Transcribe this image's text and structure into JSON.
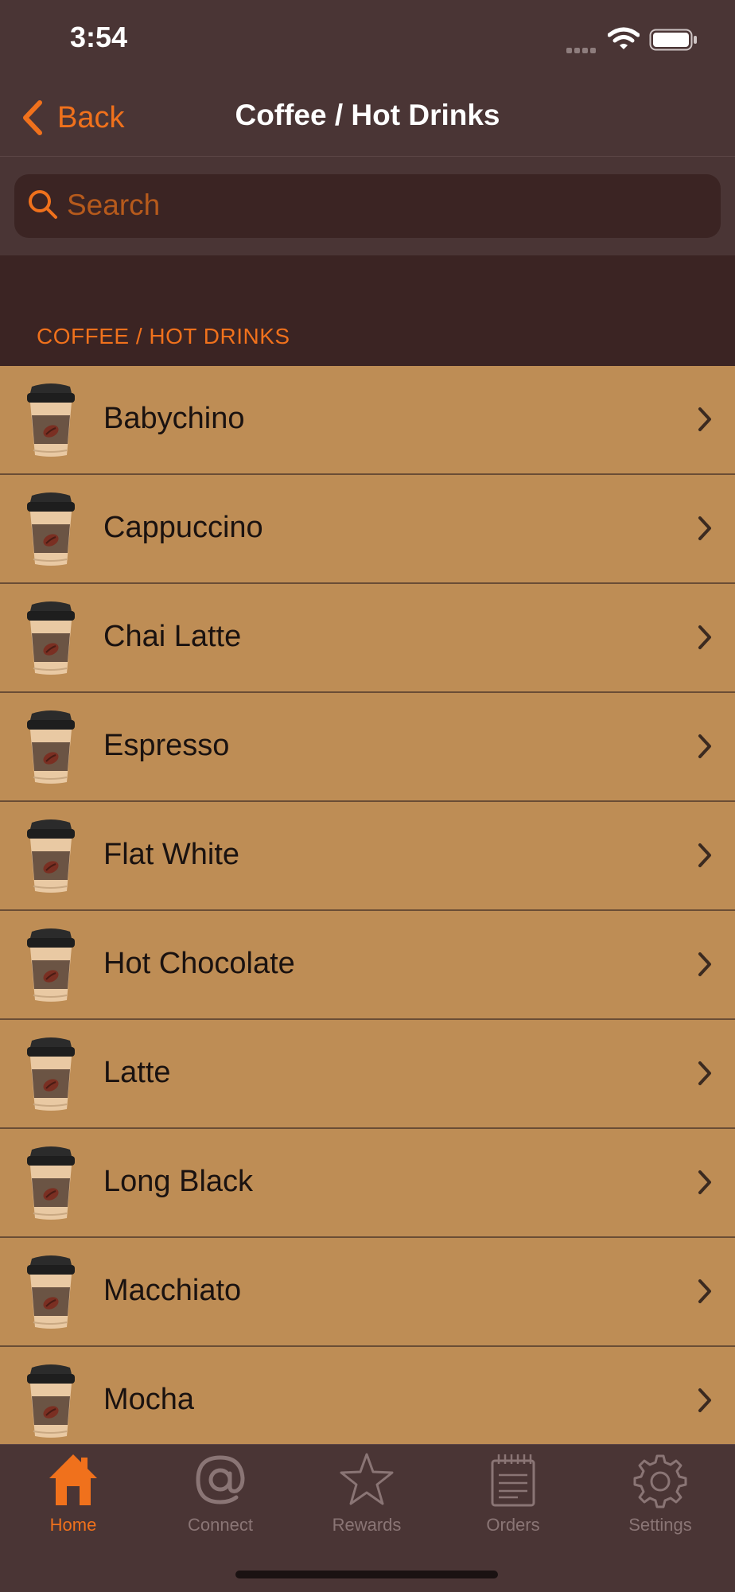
{
  "status_bar": {
    "time": "3:54"
  },
  "nav": {
    "back_label": "Back",
    "title": "Coffee / Hot Drinks"
  },
  "search": {
    "placeholder": "Search"
  },
  "section": {
    "title": "COFFEE / HOT DRINKS"
  },
  "items": [
    {
      "label": "Babychino"
    },
    {
      "label": "Cappuccino"
    },
    {
      "label": "Chai Latte"
    },
    {
      "label": "Espresso"
    },
    {
      "label": "Flat White"
    },
    {
      "label": "Hot Chocolate"
    },
    {
      "label": "Latte"
    },
    {
      "label": "Long Black"
    },
    {
      "label": "Macchiato"
    },
    {
      "label": "Mocha"
    }
  ],
  "tabs": [
    {
      "label": "Home",
      "icon": "home-icon",
      "active": true
    },
    {
      "label": "Connect",
      "icon": "at-icon",
      "active": false
    },
    {
      "label": "Rewards",
      "icon": "star-icon",
      "active": false
    },
    {
      "label": "Orders",
      "icon": "notepad-icon",
      "active": false
    },
    {
      "label": "Settings",
      "icon": "gear-icon",
      "active": false
    }
  ],
  "colors": {
    "accent": "#f0711c",
    "background": "#4a3535",
    "section_bg": "#3b2423",
    "row_bg": "#be8d55",
    "inactive": "#8a7575"
  }
}
